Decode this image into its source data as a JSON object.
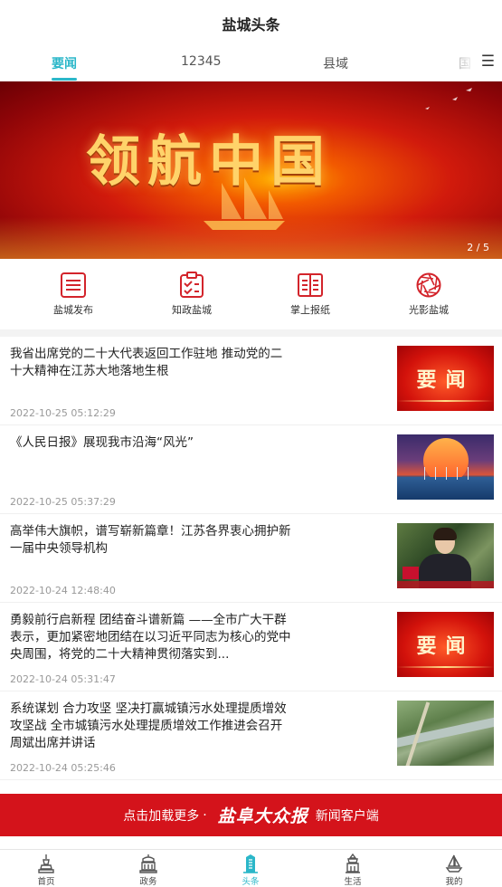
{
  "app": {
    "title": "盐城头条"
  },
  "tabs": [
    {
      "label": "要闻",
      "active": true
    },
    {
      "label": "12345",
      "active": false
    },
    {
      "label": "县域",
      "active": false
    },
    {
      "label": "国",
      "active": false
    }
  ],
  "banner": {
    "headline": "领航中国",
    "page_indicator": "2 / 5"
  },
  "shortcuts": [
    {
      "label": "盐城发布",
      "icon": "list-icon"
    },
    {
      "label": "知政盐城",
      "icon": "clipboard-check-icon"
    },
    {
      "label": "掌上报纸",
      "icon": "newspaper-icon"
    },
    {
      "label": "光影盐城",
      "icon": "camera-aperture-icon"
    }
  ],
  "news": [
    {
      "title": "我省出席党的二十大代表返回工作驻地 推动党的二十大精神在江苏大地落地生根",
      "time": "2022-10-25 05:12:29",
      "thumb": "yaowen",
      "thumb_text": "要闻"
    },
    {
      "title": "《人民日报》展现我市沿海“风光”",
      "time": "2022-10-25 05:37:29",
      "thumb": "sunset"
    },
    {
      "title": "高举伟大旗帜，谱写崭新篇章！江苏各界衷心拥护新一届中央领导机构",
      "time": "2022-10-24 12:48:40",
      "thumb": "person"
    },
    {
      "title": "勇毅前行启新程 团结奋斗谱新篇 ——全市广大干群表示，更加紧密地团结在以习近平同志为核心的党中央周围，将党的二十大精神贯彻落实到...",
      "time": "2022-10-24 05:31:47",
      "thumb": "yaowen",
      "thumb_text": "要闻"
    },
    {
      "title": "系统谋划 合力攻坚 坚决打赢城镇污水处理提质增效攻坚战 全市城镇污水处理提质增效工作推进会召开 周斌出席并讲话",
      "time": "2022-10-24 05:25:46",
      "thumb": "aerial"
    }
  ],
  "load_more": {
    "prefix": "点击加载更多",
    "separator": "·",
    "brand": "盐阜大众报",
    "suffix": "新闻客户端"
  },
  "bottom_nav": [
    {
      "label": "首页",
      "icon": "home-tower-icon",
      "active": false
    },
    {
      "label": "政务",
      "icon": "government-building-icon",
      "active": false
    },
    {
      "label": "头条",
      "icon": "headline-building-icon",
      "active": true
    },
    {
      "label": "生活",
      "icon": "life-pagoda-icon",
      "active": false
    },
    {
      "label": "我的",
      "icon": "profile-boat-icon",
      "active": false
    }
  ],
  "colors": {
    "accent": "#2bb7c9",
    "brand_red": "#d4131b",
    "shortcut_red": "#d3242b"
  }
}
